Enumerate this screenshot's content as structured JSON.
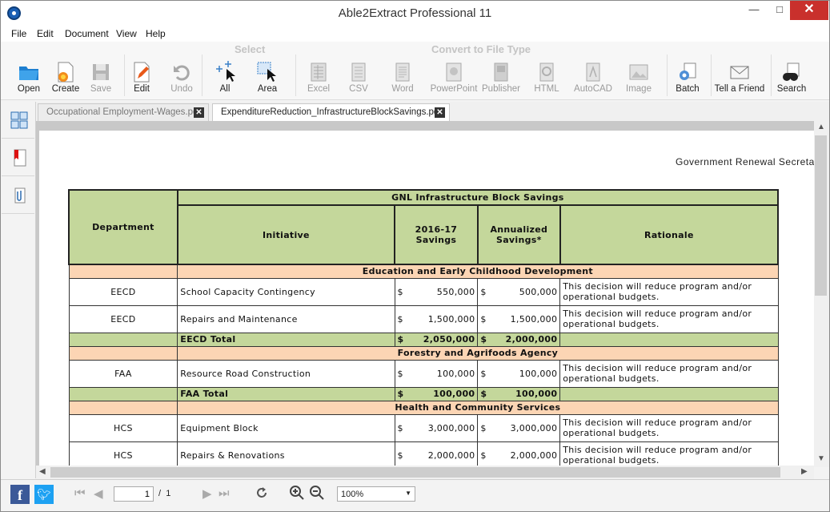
{
  "window": {
    "title": "Able2Extract Professional 11"
  },
  "menu": [
    "File",
    "Edit",
    "Document",
    "View",
    "Help"
  ],
  "ribbon": {
    "groups": {
      "select": "Select",
      "convert": "Convert to File Type"
    },
    "buttons": {
      "open": "Open",
      "create": "Create",
      "save": "Save",
      "edit": "Edit",
      "undo": "Undo",
      "all": "All",
      "area": "Area",
      "excel": "Excel",
      "csv": "CSV",
      "word": "Word",
      "powerpoint": "PowerPoint",
      "publisher": "Publisher",
      "html": "HTML",
      "autocad": "AutoCAD",
      "image": "Image",
      "batch": "Batch",
      "tell": "Tell a Friend",
      "search": "Search"
    }
  },
  "tabs": [
    {
      "label": "Occupational Employment-Wages.pdf"
    },
    {
      "label": "ExpenditureReduction_InfrastructureBlockSavings.pdf"
    }
  ],
  "document": {
    "header": "Government Renewal Secreta",
    "table": {
      "title": "GNL Infrastructure Block Savings",
      "col_department": "Department",
      "col_initiative": "Initiative",
      "col_savings_a": "2016-17",
      "col_savings_b": "Savings",
      "col_annual_a": "Annualized",
      "col_annual_b": "Savings*",
      "col_rationale": "Rationale",
      "currency": "$",
      "rationale_a": "This decision will reduce program and/or",
      "rationale_b": "operational budgets.",
      "sec_eecd": "Education and Early Childhood Development",
      "sec_faa": "Forestry and Agrifoods Agency",
      "sec_hcs": "Health and Community Services",
      "eecd1": {
        "dept": "EECD",
        "initiative": "School Capacity Contingency",
        "s1": "550,000",
        "s2": "500,000"
      },
      "eecd2": {
        "dept": "EECD",
        "initiative": "Repairs and Maintenance",
        "s1": "1,500,000",
        "s2": "1,500,000"
      },
      "eecd_total": {
        "label": "EECD Total",
        "s1": "2,050,000",
        "s2": "2,000,000"
      },
      "faa1": {
        "dept": "FAA",
        "initiative": "Resource Road Construction",
        "s1": "100,000",
        "s2": "100,000"
      },
      "faa_total": {
        "label": "FAA Total",
        "s1": "100,000",
        "s2": "100,000"
      },
      "hcs1": {
        "dept": "HCS",
        "initiative": "Equipment Block",
        "s1": "3,000,000",
        "s2": "3,000,000"
      },
      "hcs2": {
        "dept": "HCS",
        "initiative": "Repairs & Renovations",
        "s1": "2,000,000",
        "s2": "2,000,000"
      }
    }
  },
  "status": {
    "page": "1",
    "page_sep": "/",
    "page_total": "1",
    "zoom": "100%"
  }
}
